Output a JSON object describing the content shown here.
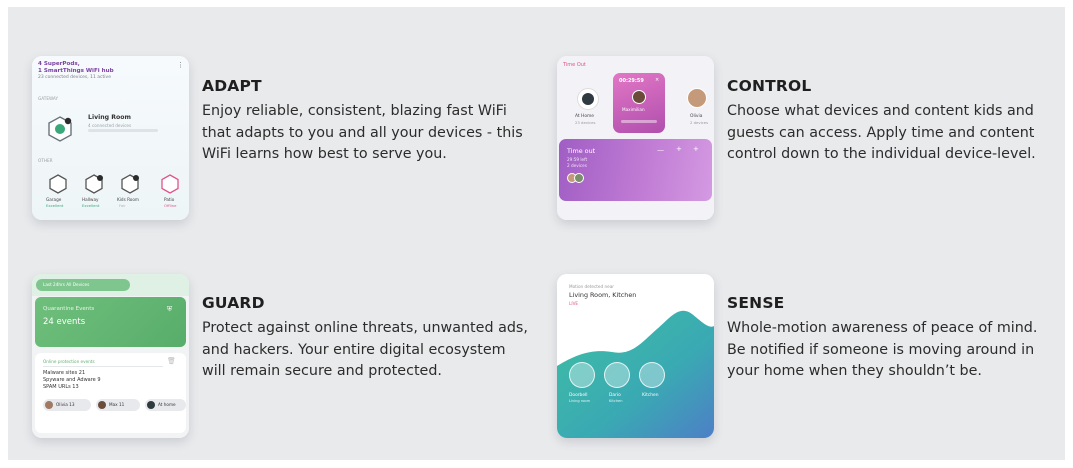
{
  "colors": {
    "panel_bg": "#e9eaec",
    "accent_purple": "#7b3fa0",
    "accent_green": "#5fb06f",
    "accent_teal": "#39b7a8",
    "timeout_purple": "#a05ec4"
  },
  "features": [
    {
      "title": "ADAPT",
      "description": "Enjoy reliable, consistent, blazing fast WiFi that adapts to you and all your devices - this WiFi learns how best to serve you.",
      "thumb": {
        "heading": "4 SuperPods,\n1 SmartThings WiFi hub",
        "sub": "23 connected devices, 11 active",
        "section1": "GATEWAY",
        "room_name": "Living Room",
        "room_sub": "4 connected devices",
        "section2": "OTHER",
        "pods": [
          "Garage",
          "Hallway",
          "Kids Room",
          "Patio"
        ],
        "pod_status": [
          "Excellent",
          "Excellent",
          "Fair",
          "Offline"
        ]
      }
    },
    {
      "title": "CONTROL",
      "description": "Choose what devices and content kids and guests can access. Apply time and content control down to the individual device-level.",
      "thumb": {
        "label": "Time Out",
        "timer": "00:29:59",
        "timer_name": "Maximilian",
        "left_person": "At Home",
        "left_sub": "23 devices",
        "right_person": "Olivia",
        "right_sub": "2 devices",
        "timeout_title": "Time out",
        "timeout_sub": "29:59 left",
        "timeout_sub2": "2 devices"
      }
    },
    {
      "title": "GUARD",
      "description": "Protect against online threats, unwanted ads, and hackers. Your entire digital ecosystem will remain secure and protected.",
      "thumb": {
        "pill": "Last 24hrs All Devices",
        "green_title": "Quarantine Events",
        "events": "24 events",
        "card_head": "Online protection events",
        "lines": [
          "Malware sites 21",
          "Spyware and Adware 9",
          "SPAM URLs 13"
        ],
        "chips": [
          "Olivia 13",
          "Max 11",
          "At home"
        ]
      }
    },
    {
      "title": "SENSE",
      "description": "Whole-motion awareness of peace of mind. Be notified if someone is moving around in your home when they shouldn’t be.",
      "thumb": {
        "small": "Motion detected near",
        "title": "Living Room, Kitchen",
        "live": "LIVE",
        "rooms": [
          "Doorbell",
          "Dario",
          "Kitchen"
        ],
        "room_sub": [
          "Living room",
          "Kitchen",
          ""
        ]
      }
    }
  ]
}
